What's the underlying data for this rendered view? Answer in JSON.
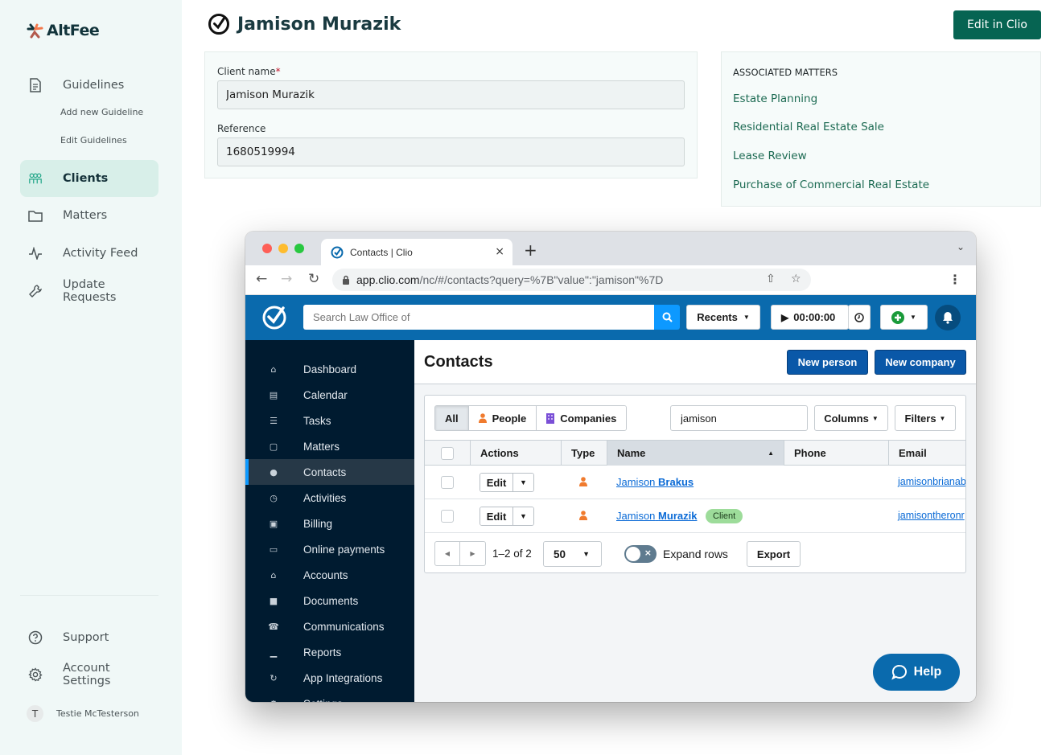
{
  "app": {
    "brand": "AltFee"
  },
  "sidebar": {
    "items": [
      {
        "label": "Guidelines",
        "icon": "document-icon"
      },
      {
        "label": "Clients",
        "icon": "users-icon",
        "active": true
      },
      {
        "label": "Matters",
        "icon": "folder-icon"
      },
      {
        "label": "Activity Feed",
        "icon": "activity-icon"
      },
      {
        "label": "Update Requests",
        "icon": "wrench-icon"
      }
    ],
    "sub_items": [
      "Add new Guideline",
      "Edit Guidelines"
    ],
    "bottom_items": [
      {
        "label": "Support",
        "icon": "help-circle-icon"
      },
      {
        "label": "Account Settings",
        "icon": "gear-icon"
      }
    ],
    "user": {
      "initial": "T",
      "name": "Testie McTesterson"
    }
  },
  "header": {
    "title": "Jamison Murazik",
    "edit_button": "Edit in Clio"
  },
  "client_form": {
    "name_label": "Client name",
    "required_mark": "*",
    "name_value": "Jamison Murazik",
    "reference_label": "Reference",
    "reference_value": "1680519994"
  },
  "associated_matters": {
    "heading": "ASSOCIATED MATTERS",
    "items": [
      "Estate Planning",
      "Residential Real Estate Sale",
      "Lease Review",
      "Purchase of Commercial Real Estate"
    ]
  },
  "browser": {
    "tab_title": "Contacts | Clio",
    "url_host": "app.clio.com",
    "url_path": "/nc/#/contacts?query=%7B\"value\":\"jamison\"%7D",
    "new_tab": "+",
    "close": "×"
  },
  "clio": {
    "search_placeholder": "Search Law Office of",
    "recents": "Recents",
    "timer": "00:00:00",
    "nav": [
      {
        "label": "Dashboard",
        "icon": "home-icon"
      },
      {
        "label": "Calendar",
        "icon": "calendar-icon"
      },
      {
        "label": "Tasks",
        "icon": "list-icon"
      },
      {
        "label": "Matters",
        "icon": "briefcase-icon"
      },
      {
        "label": "Contacts",
        "icon": "person-icon",
        "active": true
      },
      {
        "label": "Activities",
        "icon": "clock-icon"
      },
      {
        "label": "Billing",
        "icon": "money-icon"
      },
      {
        "label": "Online payments",
        "icon": "credit-card-icon"
      },
      {
        "label": "Accounts",
        "icon": "bank-icon"
      },
      {
        "label": "Documents",
        "icon": "folder-icon"
      },
      {
        "label": "Communications",
        "icon": "phone-icon"
      },
      {
        "label": "Reports",
        "icon": "bar-chart-icon"
      },
      {
        "label": "App Integrations",
        "icon": "sync-icon"
      },
      {
        "label": "Settings",
        "icon": "gear-icon"
      }
    ],
    "page_title": "Contacts",
    "new_person": "New person",
    "new_company": "New company",
    "filters": {
      "segments": [
        "All",
        "People",
        "Companies"
      ],
      "active_segment": "All",
      "search_value": "jamison",
      "columns": "Columns",
      "filters": "Filters"
    },
    "table": {
      "headers": [
        "Actions",
        "Type",
        "Name",
        "Phone",
        "Email"
      ],
      "sorted_column": "Name",
      "rows": [
        {
          "first": "Jamison",
          "last": "Brakus",
          "badge": null,
          "phone": "",
          "email": "jamisonbrianab"
        },
        {
          "first": "Jamison",
          "last": "Murazik",
          "badge": "Client",
          "phone": "",
          "email": "jamisontheronr"
        }
      ],
      "edit_label": "Edit"
    },
    "footer": {
      "range": "1–2 of 2",
      "per_page": "50",
      "expand_rows": "Expand rows",
      "expand_rows_on": false,
      "export": "Export"
    },
    "help": "Help"
  },
  "colors": {
    "brand_green": "#066452",
    "clio_blue": "#0a6aad",
    "clio_nav": "#001b30",
    "link_green": "#1c6a52"
  }
}
